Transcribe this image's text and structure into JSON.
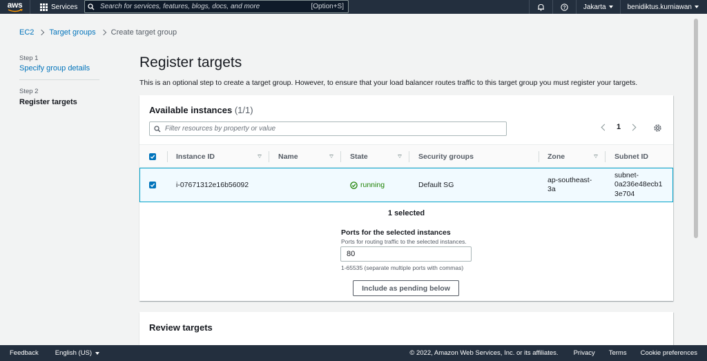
{
  "topnav": {
    "logo": "aws",
    "services_label": "Services",
    "search_placeholder": "Search for services, features, blogs, docs, and more",
    "search_shortcut": "[Option+S]",
    "region": "Jakarta",
    "user": "benidiktus.kurniawan"
  },
  "breadcrumb": {
    "items": [
      "EC2",
      "Target groups",
      "Create target group"
    ]
  },
  "steps": [
    {
      "number": "Step 1",
      "label": "Specify group details"
    },
    {
      "number": "Step 2",
      "label": "Register targets"
    }
  ],
  "main": {
    "title": "Register targets",
    "description": "This is an optional step to create a target group. However, to ensure that your load balancer routes traffic to this target group you must register your targets."
  },
  "available": {
    "title": "Available instances",
    "count": "(1/1)",
    "filter_placeholder": "Filter resources by property or value",
    "page": "1",
    "columns": [
      "Instance ID",
      "Name",
      "State",
      "Security groups",
      "Zone",
      "Subnet ID"
    ],
    "rows": [
      {
        "instance_id": "i-07671312e16b56092",
        "name": "",
        "state": "running",
        "security_groups": "Default SG",
        "zone_line1": "ap-southeast-",
        "zone_line2": "3a",
        "subnet_line1": "subnet-",
        "subnet_line2": "0a236e48ecb1",
        "subnet_line3": "3e704"
      }
    ],
    "selected_text": "1 selected",
    "ports_label": "Ports for the selected instances",
    "ports_desc": "Ports for routing traffic to the selected instances.",
    "ports_value": "80",
    "ports_hint": "1-65535 (separate multiple ports with commas)",
    "include_button": "Include as pending below"
  },
  "review": {
    "title": "Review targets"
  },
  "footer": {
    "feedback": "Feedback",
    "language": "English (US)",
    "copyright": "© 2022, Amazon Web Services, Inc. or its affiliates.",
    "privacy": "Privacy",
    "terms": "Terms",
    "cookies": "Cookie preferences"
  },
  "colors": {
    "nav_bg": "#232f3e",
    "link": "#0073bb",
    "running": "#1d8102",
    "selected_row_bg": "#f1faff",
    "selected_row_border": "#00a1c9"
  }
}
